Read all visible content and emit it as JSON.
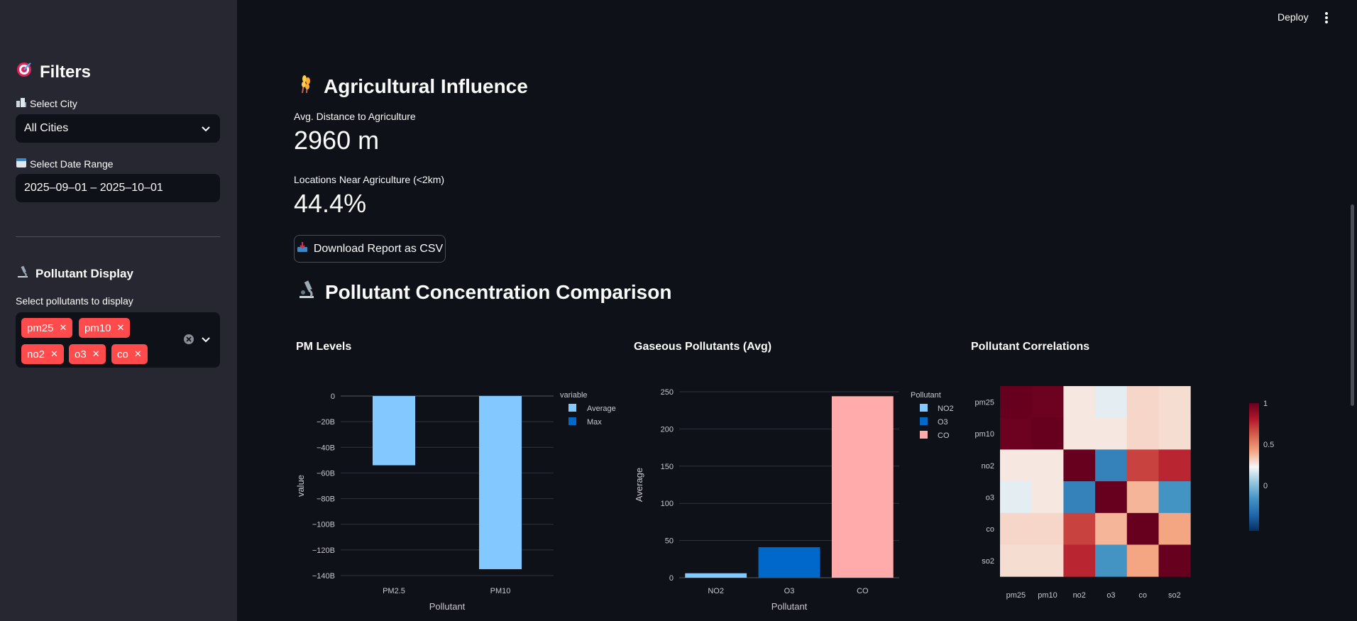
{
  "sidebar": {
    "filters_icon": "target-icon",
    "filters_title": "Filters",
    "city_label": "Select City",
    "city_value": "All Cities",
    "date_label": "Select Date Range",
    "date_value": "2025–09–01 – 2025–10–01",
    "pollutant_title": "Pollutant Display",
    "pollutant_label": "Select pollutants to display",
    "pollutant_tags": [
      "pm25",
      "pm10",
      "no2",
      "o3",
      "co"
    ]
  },
  "header": {
    "deploy_label": "Deploy"
  },
  "agri": {
    "title": "Agricultural Influence",
    "icon": "wheat-icon",
    "metric1_label": "Avg. Distance to Agriculture",
    "metric1_value": "2960 m",
    "metric2_label": "Locations Near Agriculture (<2km)",
    "metric2_value": "44.4%",
    "download_label": "Download Report as CSV"
  },
  "pollutant_section": {
    "title": "Pollutant Concentration Comparison",
    "icon": "microscope-icon"
  },
  "chart_data": [
    {
      "type": "bar",
      "title": "PM Levels",
      "xlabel": "Pollutant",
      "ylabel": "value",
      "categories": [
        "PM2.5",
        "PM10"
      ],
      "series": [
        {
          "name": "Average",
          "values": [
            -54,
            -135
          ],
          "color": "#83c9ff"
        },
        {
          "name": "Max",
          "values": [
            null,
            null
          ],
          "color": "#0068c9"
        }
      ],
      "legend_title": "variable",
      "ylim": [
        -140,
        0
      ],
      "yticks": [
        0,
        -20,
        -40,
        -60,
        -80,
        -100,
        -120,
        -140
      ],
      "yticklabels": [
        "0",
        "−20B",
        "−40B",
        "−60B",
        "−80B",
        "−100B",
        "−120B",
        "−140B"
      ]
    },
    {
      "type": "bar",
      "title": "Gaseous Pollutants (Avg)",
      "xlabel": "Pollutant",
      "ylabel": "Average",
      "categories": [
        "NO2",
        "O3",
        "CO"
      ],
      "values": [
        6,
        41,
        244
      ],
      "colors": [
        "#83c9ff",
        "#0068c9",
        "#ffabab"
      ],
      "legend_title": "Pollutant",
      "legend": [
        "NO2",
        "O3",
        "CO"
      ],
      "ylim": [
        0,
        250
      ],
      "yticks": [
        0,
        50,
        100,
        150,
        200,
        250
      ]
    },
    {
      "type": "heatmap",
      "title": "Pollutant Correlations",
      "labels": [
        "pm25",
        "pm10",
        "no2",
        "o3",
        "co",
        "so2"
      ],
      "matrix": [
        [
          1.0,
          0.98,
          0.05,
          -0.05,
          0.1,
          0.08
        ],
        [
          0.98,
          1.0,
          0.05,
          0.05,
          0.1,
          0.08
        ],
        [
          0.05,
          0.05,
          1.0,
          -0.6,
          0.6,
          0.7
        ],
        [
          -0.05,
          0.05,
          -0.6,
          1.0,
          0.2,
          -0.5
        ],
        [
          0.1,
          0.1,
          0.6,
          0.2,
          1.0,
          0.25
        ],
        [
          0.08,
          0.08,
          0.7,
          -0.5,
          0.25,
          1.0
        ]
      ],
      "colorbar_ticks": [
        "1",
        "0.5",
        "0"
      ],
      "colorscale": [
        "#053061",
        "#2166ac",
        "#4393c3",
        "#92c5de",
        "#f7f7f7",
        "#f4a582",
        "#d6604d",
        "#b2182b",
        "#67001f"
      ]
    }
  ]
}
